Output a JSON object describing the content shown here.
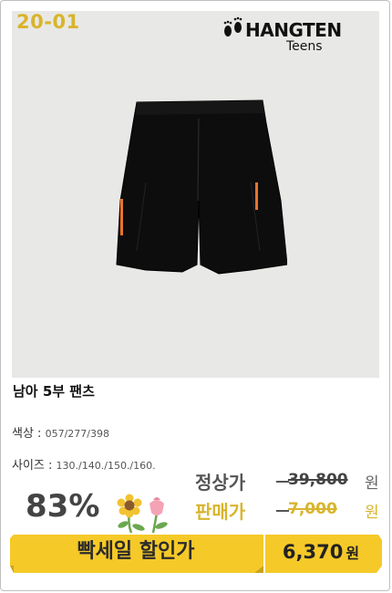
{
  "badge": {
    "code": "20-01"
  },
  "brand": {
    "name": "HANGTEN",
    "sub": "Teens",
    "logo_icon": "footprints-icon"
  },
  "product": {
    "name": "남아 5부 팬츠",
    "color_label": "색상 :",
    "color_value": "057/277/398",
    "size_label": "사이즈 :",
    "size_value": "130./140./150./160."
  },
  "pricing": {
    "discount": "83%",
    "regular_label": "정상가",
    "regular_price": "39,800",
    "sale_label": "판매가",
    "sale_price": "7,000",
    "currency": "원"
  },
  "banner": {
    "text": "빡세일 할인가",
    "final_price": "6,370",
    "currency": "원"
  },
  "colors": {
    "accent": "#F5C928",
    "accent_text": "#D8B52E",
    "photo_bg": "#E8E8E6"
  }
}
